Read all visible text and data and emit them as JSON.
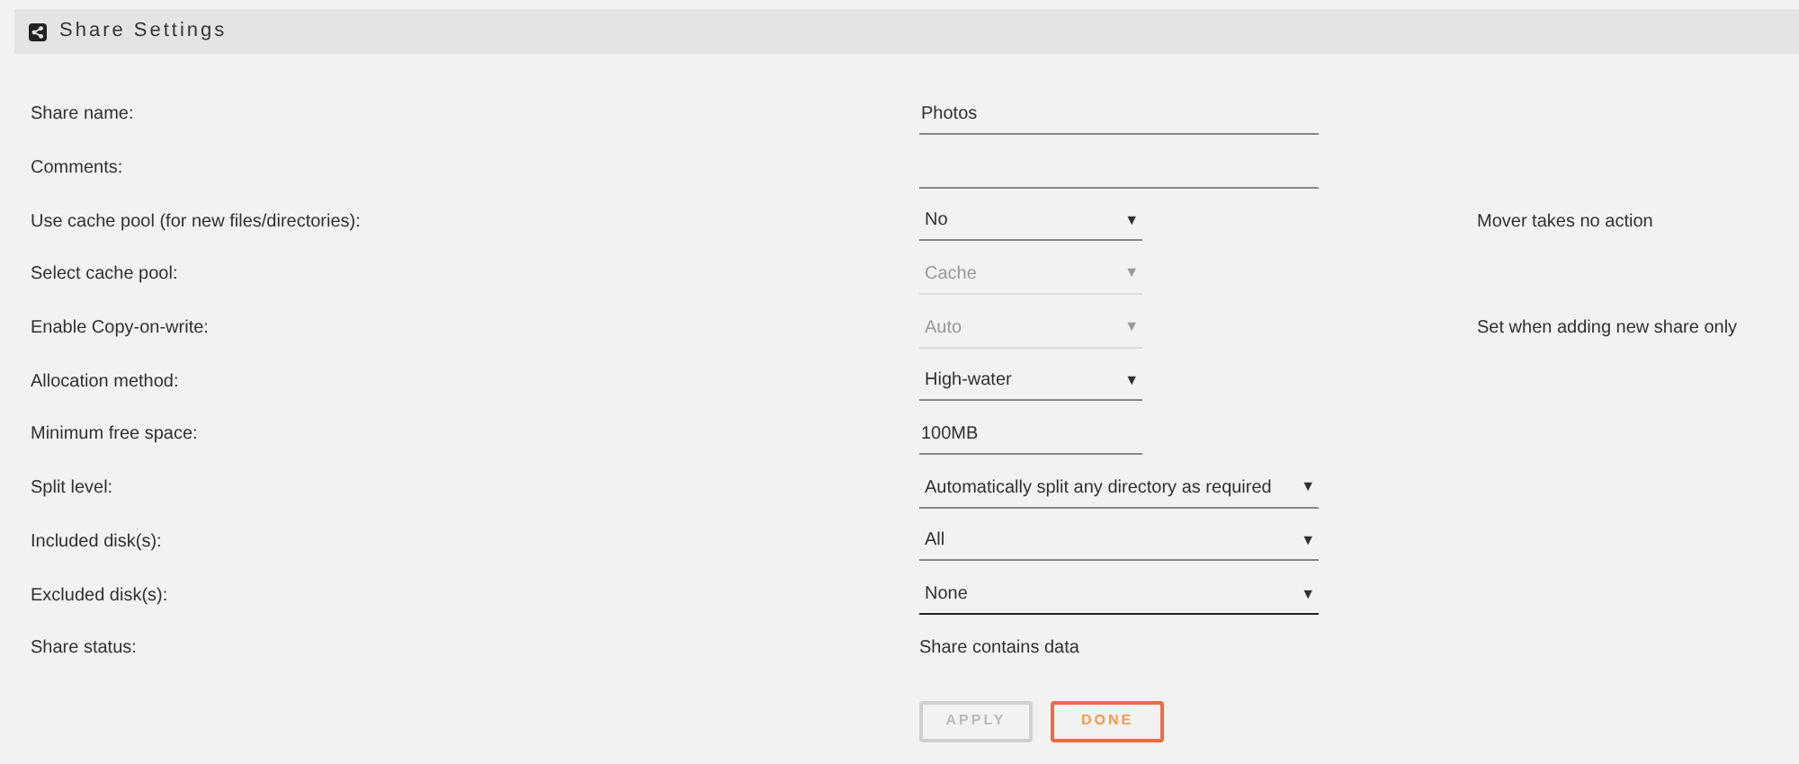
{
  "header": {
    "title": "Share Settings"
  },
  "rows": [
    {
      "label": "Share name:",
      "kind": "input",
      "value": "Photos"
    },
    {
      "label": "Comments:",
      "kind": "input"
    },
    {
      "label": "Use cache pool (for new files/directories):",
      "kind": "select",
      "value": "No",
      "disabled": false,
      "focused": false,
      "caret": "▼",
      "note": "Mover takes no action"
    },
    {
      "label": "Select cache pool:",
      "kind": "select",
      "value": "Cache",
      "disabled": true,
      "focused": false,
      "caret": "▼"
    },
    {
      "label": "Enable Copy-on-write:",
      "kind": "select",
      "value": "Auto",
      "disabled": true,
      "focused": false,
      "caret": "▼",
      "note": "Set when adding new share only"
    },
    {
      "label": "Allocation method:",
      "kind": "select",
      "value": "High-water",
      "disabled": false,
      "focused": false,
      "caret": "▼"
    },
    {
      "label": "Minimum free space:",
      "kind": "input",
      "value": "100MB"
    },
    {
      "label": "Split level:",
      "kind": "select",
      "value": "Automatically split any directory as required",
      "disabled": false,
      "focused": false,
      "caret": "▼"
    },
    {
      "label": "Included disk(s):",
      "kind": "select",
      "value": "All",
      "disabled": false,
      "focused": false,
      "caret": "▼"
    },
    {
      "label": "Excluded disk(s):",
      "kind": "select",
      "value": "None",
      "disabled": false,
      "focused": true,
      "caret": "▼"
    },
    {
      "label": "Share status:",
      "kind": "status",
      "value": "Share contains data"
    }
  ],
  "buttons": [
    {
      "label": "APPLY",
      "disabled": true
    },
    {
      "label": "DONE",
      "disabled": false
    }
  ]
}
